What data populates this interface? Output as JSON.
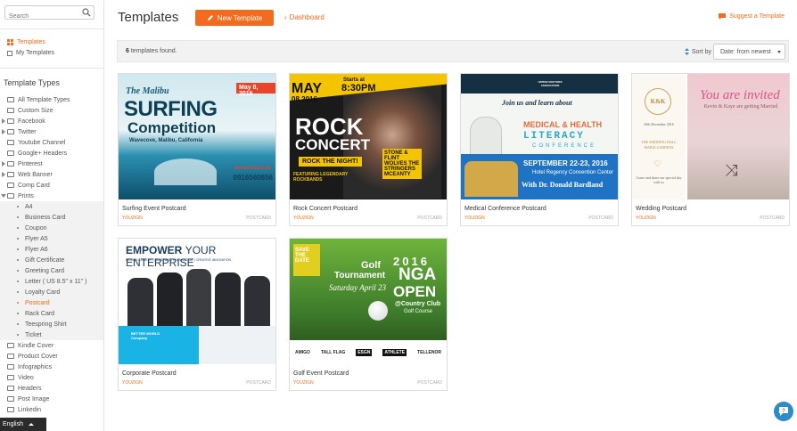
{
  "sidebar": {
    "search_placeholder": "Search",
    "links": [
      {
        "label": "Templates",
        "icon": "grid-icon",
        "active": true
      },
      {
        "label": "My Templates",
        "icon": "square-icon",
        "active": false
      }
    ],
    "section_title": "Template Types",
    "types": [
      {
        "label": "All Template Types",
        "caret": false
      },
      {
        "label": "Custom Size",
        "caret": false
      },
      {
        "label": "Facebook",
        "caret": true
      },
      {
        "label": "Twitter",
        "caret": true
      },
      {
        "label": "Youtube Channel",
        "caret": false
      },
      {
        "label": "Google+ Headers",
        "caret": false
      },
      {
        "label": "Pinterest",
        "caret": true
      },
      {
        "label": "Web Banner",
        "caret": true
      },
      {
        "label": "Comp Card",
        "caret": false
      },
      {
        "label": "Prints",
        "caret": "down"
      }
    ],
    "prints_children": [
      {
        "label": "A4"
      },
      {
        "label": "Business Card"
      },
      {
        "label": "Coupon"
      },
      {
        "label": "Flyer A5"
      },
      {
        "label": "Flyer A6"
      },
      {
        "label": "Gift Certificate"
      },
      {
        "label": "Greeting Card"
      },
      {
        "label": "Letter ( US 8.5\" x 11\" )"
      },
      {
        "label": "Loyalty Card"
      },
      {
        "label": "Postcard",
        "active": true
      },
      {
        "label": "Rack Card"
      },
      {
        "label": "Teespring Shirt"
      },
      {
        "label": "Ticket"
      }
    ],
    "types_after": [
      {
        "label": "Kindle Cover"
      },
      {
        "label": "Product Cover"
      },
      {
        "label": "Infographics"
      },
      {
        "label": "Video"
      },
      {
        "label": "Headers"
      },
      {
        "label": "Post Image"
      },
      {
        "label": "Linkedin"
      }
    ],
    "language": "English"
  },
  "header": {
    "title": "Templates",
    "new_button": "New Template",
    "dashboard_link": "Dashboard",
    "suggest_link": "Suggest a Template"
  },
  "toolbar": {
    "count": "6",
    "count_suffix": " templates found.",
    "sort_label": "Sort by",
    "sort_value": "Date: from newest"
  },
  "templates": [
    {
      "name": "Surfing Event Postcard",
      "author": "YOUZIGN",
      "type": "POSTCARD",
      "art": {
        "line1": "The Malibu",
        "line2": "SURFING",
        "line3": "Competition",
        "line4": "Wavecove, Malibu, California",
        "date": "May 8, 2016",
        "phone": "0916560856",
        "site": "alexsurfclub.com"
      }
    },
    {
      "name": "Rock Concert Postcard",
      "author": "YOUZIGN",
      "type": "POSTCARD",
      "art": {
        "month": "MAY",
        "day": "08",
        "year": "2016",
        "start": "Starts at",
        "time": "8:30PM",
        "line1": "ROCK",
        "line2": "CONCERT",
        "line3": "ROCK THE NIGHT!",
        "line4": "FEATURING LEGENDARY ROCKBANDS",
        "bands": "STONE & FLINT WOLVES THE STRINGERS MCEANTY"
      }
    },
    {
      "name": "Medical Conference Postcard",
      "author": "YOUZIGN",
      "type": "POSTCARD",
      "art": {
        "org": "UNITED DOCTORS ASSOCIATION",
        "tag": "Join us and learn about",
        "line1": "MEDICAL & HEALTH",
        "line2": "LITERACY",
        "line3": "CONFERENCE",
        "date": "SEPTEMBER 22-23, 2016",
        "venue": "Hotel Regency Convention Center",
        "with": "With Dr. Donald Bardland"
      }
    },
    {
      "name": "Wedding Postcard",
      "author": "YOUZIGN",
      "type": "POSTCARD",
      "art": {
        "mono": "K&K",
        "invite": "You are invited",
        "names": "Kevin & Kaye are getting Married",
        "date": "20th December 2016",
        "hall": "THE WEDDING HALL",
        "place": "MARIA GARDENS",
        "note": "Come and share our special day with us"
      }
    },
    {
      "name": "Corporate Postcard",
      "author": "YOUZIGN",
      "type": "POSTCARD",
      "art": {
        "line1": "EMPOWER",
        "line2": "YOUR ENTERPRISE",
        "sub": "DESIGN CONCEPT | BUSINESS KNOWLEDGE | CREATIVE INNOVATION",
        "company": "BETTER WORLD Company"
      }
    },
    {
      "name": "Golf Event Postcard",
      "author": "YOUZIGN",
      "type": "POSTCARD",
      "art": {
        "save": "SAVE THE DATE",
        "year": "2016",
        "golf": "Golf",
        "tournament": "Tournament",
        "date": "Saturday April 23",
        "nga": "NGA",
        "open": "OPEN",
        "club": "@Country Club",
        "course": "Golf Course",
        "s1": "AMIGO",
        "s2": "TALL FLAG",
        "s3": "ESGN",
        "s4": "ATHLETE",
        "s5": "TELLENOR"
      }
    }
  ]
}
